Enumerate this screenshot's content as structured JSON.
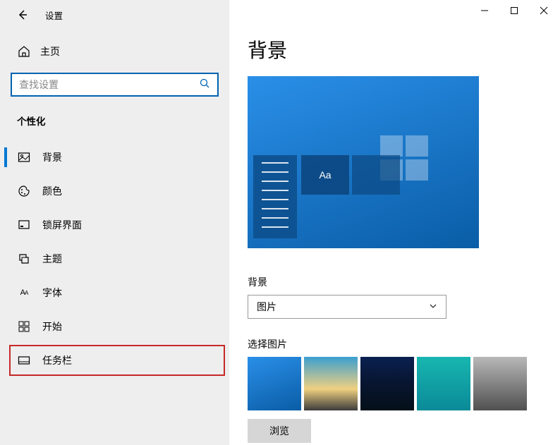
{
  "app": {
    "title": "设置"
  },
  "sidebar": {
    "home": "主页",
    "search_placeholder": "查找设置",
    "section": "个性化",
    "items": [
      {
        "label": "背景",
        "active": true
      },
      {
        "label": "颜色"
      },
      {
        "label": "锁屏界面"
      },
      {
        "label": "主题"
      },
      {
        "label": "字体"
      },
      {
        "label": "开始"
      },
      {
        "label": "任务栏",
        "highlight": true
      }
    ]
  },
  "main": {
    "title": "背景",
    "preview_sample": "Aa",
    "bg_label": "背景",
    "bg_value": "图片",
    "choose_label": "选择图片",
    "browse": "浏览"
  }
}
